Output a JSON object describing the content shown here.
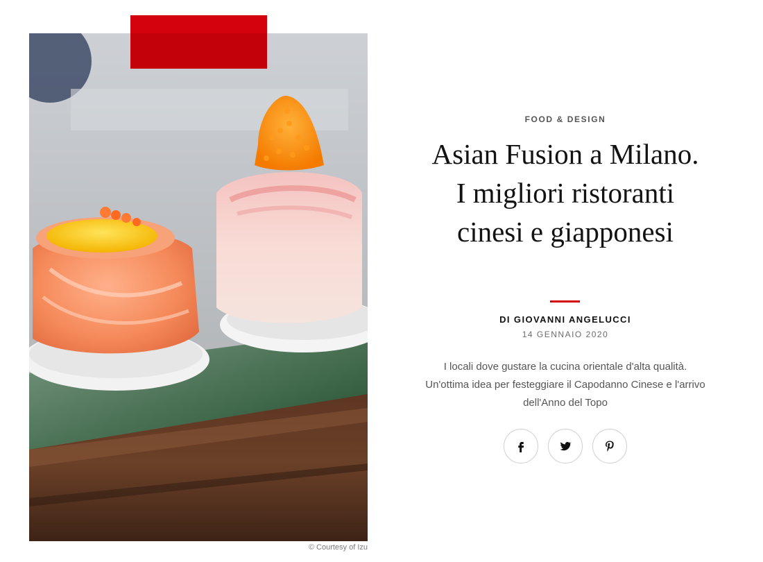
{
  "hero": {
    "image_alt": "Sushi rolls with salmon and shrimp topped with orange roe on a wooden tray",
    "credit": "© Courtesy of Izu"
  },
  "article": {
    "kicker": "FOOD & DESIGN",
    "title": "Asian Fusion a Milano. I migliori ristoranti cinesi e giapponesi",
    "author": "DI GIOVANNI ANGELUCCI",
    "date": "14 GENNAIO 2020",
    "summary": "I locali dove gustare la cucina orientale d'alta qualità. Un'ottima idea per festeggiare il Capodanno Cinese e l'arrivo dell'Anno del Topo"
  },
  "social": [
    {
      "icon": "facebook-icon"
    },
    {
      "icon": "twitter-icon"
    },
    {
      "icon": "pinterest-icon"
    }
  ],
  "colors": {
    "accent_red": "#d3020c",
    "text_dark": "#121212",
    "text_muted": "#555555"
  }
}
